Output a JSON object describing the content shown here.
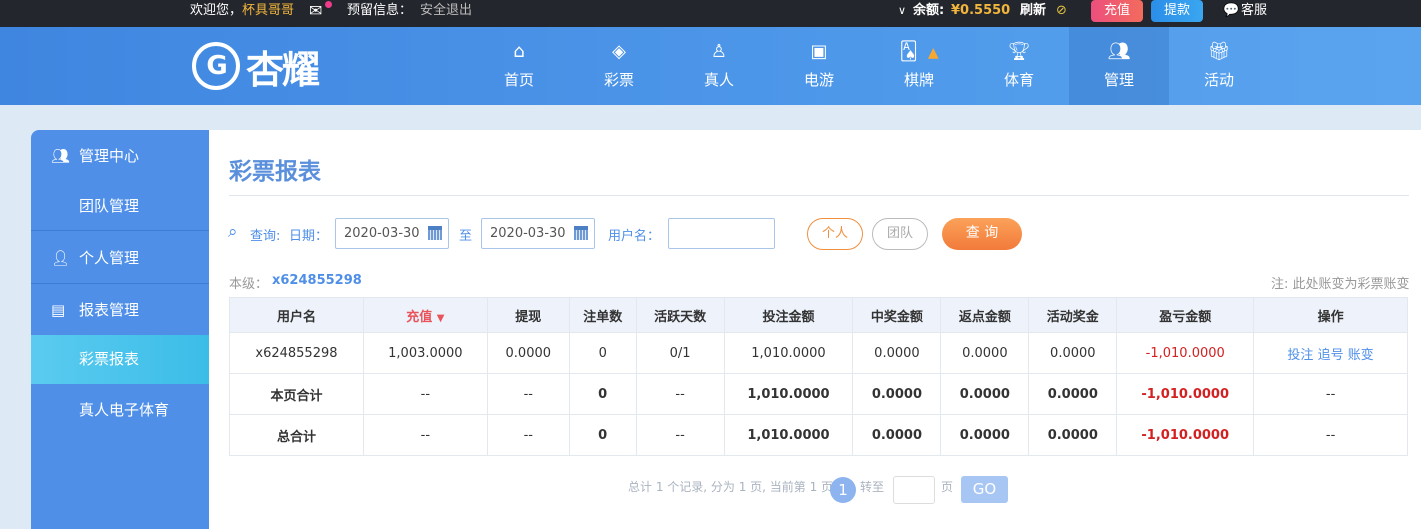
{
  "topbar": {
    "welcome": "欢迎您，",
    "username": "杯具哥哥",
    "reserved": "预留信息：",
    "logout": "安全退出",
    "balance_label": "余额:",
    "balance": "¥0.5550",
    "refresh": "刷新",
    "recharge": "充值",
    "withdraw": "提款",
    "service": "客服"
  },
  "logo": {
    "text": "杏耀"
  },
  "nav": [
    {
      "label": "首页",
      "icon": "home-icon"
    },
    {
      "label": "彩票",
      "icon": "ticket-icon"
    },
    {
      "label": "真人",
      "icon": "dealer-icon"
    },
    {
      "label": "电游",
      "icon": "slot-icon"
    },
    {
      "label": "棋牌",
      "icon": "cards-icon"
    },
    {
      "label": "体育",
      "icon": "trophy-icon"
    },
    {
      "label": "管理",
      "icon": "users-icon",
      "active": true
    },
    {
      "label": "活动",
      "icon": "gift-icon"
    }
  ],
  "sidebar": {
    "items": [
      {
        "label": "管理中心"
      },
      {
        "label": "团队管理"
      },
      {
        "label": "个人管理"
      },
      {
        "label": "报表管理"
      },
      {
        "label": "彩票报表",
        "active": true
      },
      {
        "label": "真人电子体育"
      }
    ]
  },
  "page": {
    "title": "彩票报表"
  },
  "filters": {
    "query": "查询:",
    "date_label": "日期：",
    "date_from": "2020-03-30",
    "to": "至",
    "date_to": "2020-03-30",
    "user_label": "用户名：",
    "user_value": "",
    "personal": "个人",
    "team": "团队",
    "search": "查 询"
  },
  "level": {
    "label": "本级：",
    "value": "x624855298"
  },
  "note": "注: 此处账变为彩票账变",
  "table": {
    "headers": [
      "用户名",
      "充值",
      "提现",
      "注单数",
      "活跃天数",
      "投注金额",
      "中奖金额",
      "返点金额",
      "活动奖金",
      "盈亏金额",
      "操作"
    ],
    "rows": [
      [
        "x624855298",
        "1,003.0000",
        "0.0000",
        "0",
        "0/1",
        "1,010.0000",
        "0.0000",
        "0.0000",
        "0.0000",
        "-1,010.0000"
      ],
      [
        "本页合计",
        "--",
        "--",
        "0",
        "--",
        "1,010.0000",
        "0.0000",
        "0.0000",
        "0.0000",
        "-1,010.0000",
        "--"
      ],
      [
        "总合计",
        "--",
        "--",
        "0",
        "--",
        "1,010.0000",
        "0.0000",
        "0.0000",
        "0.0000",
        "-1,010.0000",
        "--"
      ]
    ],
    "actions": [
      "投注",
      "追号",
      "账变"
    ]
  },
  "pager": {
    "summary": "总计 1 个记录, 分为 1 页, 当前第 1 页",
    "current": "1",
    "goto": "转至",
    "page_unit": "页",
    "go": "GO"
  },
  "colors": {
    "accent": "#4f8fe8",
    "loss": "#d32020",
    "orange": "#f5813f"
  }
}
